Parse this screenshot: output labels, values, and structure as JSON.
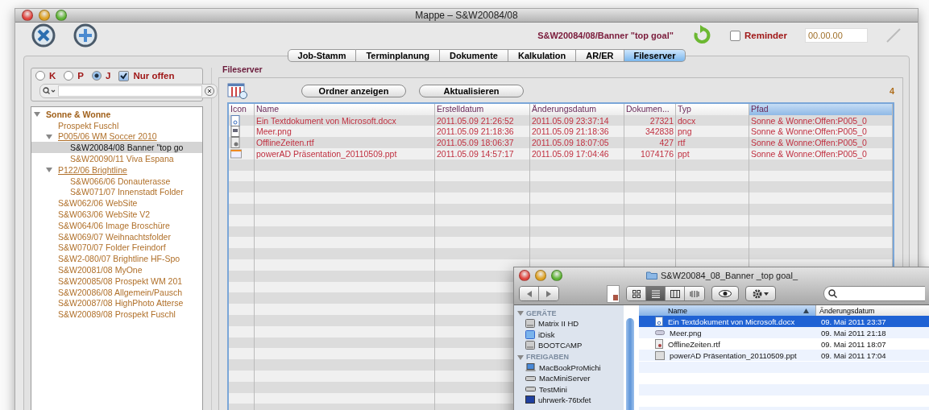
{
  "window": {
    "title": "Mappe – S&W20084/08"
  },
  "toolbar": {
    "job_title": "S&W20084/08/Banner \"top goal\"",
    "reminder": {
      "label": "Reminder",
      "checked": false
    },
    "date_field": {
      "value": "00.00.00"
    }
  },
  "tabs": [
    {
      "label": "Job-Stamm",
      "selected": false
    },
    {
      "label": "Terminplanung",
      "selected": false
    },
    {
      "label": "Dokumente",
      "selected": false
    },
    {
      "label": "Kalkulation",
      "selected": false
    },
    {
      "label": "AR/ER",
      "selected": false
    },
    {
      "label": "Fileserver",
      "selected": true
    }
  ],
  "filter": {
    "radios": [
      {
        "label": "K",
        "selected": false
      },
      {
        "label": "P",
        "selected": false
      },
      {
        "label": "J",
        "selected": true
      }
    ],
    "open_only": {
      "label": "Nur offen",
      "checked": true
    }
  },
  "tree": [
    {
      "label": "Sonne & Wonne",
      "kind": "client",
      "selected": false,
      "expanded": true,
      "children": [
        {
          "label": "Prospekt Fuschl",
          "kind": "job",
          "selected": false
        },
        {
          "label": "P005/06 WM Soccer 2010",
          "kind": "project",
          "selected": false,
          "expanded": true,
          "children": [
            {
              "label": "S&W20084/08 Banner \"top go",
              "kind": "job",
              "selected": true
            },
            {
              "label": "S&W20090/11 Viva Espana",
              "kind": "job",
              "selected": false
            }
          ]
        },
        {
          "label": "P122/06 Brightline",
          "kind": "project",
          "selected": false,
          "expanded": true,
          "children": [
            {
              "label": "S&W066/06 Donauterasse",
              "kind": "job",
              "selected": false
            },
            {
              "label": "S&W071/07 Innenstadt Folder",
              "kind": "job",
              "selected": false
            }
          ]
        },
        {
          "label": "S&W062/06 WebSite",
          "kind": "job",
          "selected": false
        },
        {
          "label": "S&W063/06 WebSite V2",
          "kind": "job",
          "selected": false
        },
        {
          "label": "S&W064/06 Image Broschüre",
          "kind": "job",
          "selected": false
        },
        {
          "label": "S&W069/07 Weihnachtsfolder",
          "kind": "job",
          "selected": false
        },
        {
          "label": "S&W070/07 Folder Freindorf",
          "kind": "job",
          "selected": false
        },
        {
          "label": "S&W2-080/07 Brightline HF-Spo",
          "kind": "job",
          "selected": false
        },
        {
          "label": "S&W20081/08 MyOne",
          "kind": "job",
          "selected": false
        },
        {
          "label": "S&W20085/08 Prospekt WM 201",
          "kind": "job",
          "selected": false
        },
        {
          "label": "S&W20086/08 Allgemein/Pausch",
          "kind": "job",
          "selected": false
        },
        {
          "label": "S&W20087/08 HighPhoto Atterse",
          "kind": "job",
          "selected": false
        },
        {
          "label": "S&W20089/08 Prospekt Fuschl",
          "kind": "job",
          "selected": false
        }
      ]
    }
  ],
  "fileserver": {
    "title": "Fileserver",
    "buttons": [
      "Ordner anzeigen",
      "Aktualisieren"
    ],
    "count": "4",
    "table": {
      "columns": [
        {
          "label": "Icon",
          "selected": false
        },
        {
          "label": "Name",
          "selected": false
        },
        {
          "label": "Erstelldatum",
          "selected": false
        },
        {
          "label": "Änderungsdatum",
          "selected": false
        },
        {
          "label": "Dokumen...",
          "selected": false
        },
        {
          "label": "Typ",
          "selected": false
        },
        {
          "label": "Pfad",
          "selected": true
        }
      ],
      "rows": [
        {
          "kind": "docx",
          "cells": [
            "",
            "Ein Textdokument von Microsoft.docx",
            "2011.05.09 21:26:52",
            "2011.05.09 23:37:14",
            "27321",
            "docx",
            "Sonne & Wonne:Offen:P005_0"
          ]
        },
        {
          "kind": "png",
          "cells": [
            "",
            "Meer.png",
            "2011.05.09 21:18:36",
            "2011.05.09 21:18:36",
            "342838",
            "png",
            "Sonne & Wonne:Offen:P005_0"
          ]
        },
        {
          "kind": "rtf",
          "cells": [
            "",
            "OfflineZeiten.rtf",
            "2011.05.09 18:06:37",
            "2011.05.09 18:07:05",
            "427",
            "rtf",
            "Sonne & Wonne:Offen:P005_0"
          ]
        },
        {
          "kind": "ppt",
          "cells": [
            "",
            "powerAD Präsentation_20110509.ppt",
            "2011.05.09 14:57:17",
            "2011.05.09 17:04:46",
            "1074176",
            "ppt",
            "Sonne & Wonne:Offen:P005_0"
          ]
        }
      ]
    }
  },
  "finder": {
    "title": "S&W20084_08_Banner _top goal_",
    "view_modes": [
      {
        "kind": "icons",
        "selected": false
      },
      {
        "kind": "list",
        "selected": true
      },
      {
        "kind": "columns",
        "selected": false
      },
      {
        "kind": "coverflow",
        "selected": false
      }
    ],
    "sidebar": [
      {
        "heading": "GERÄTE",
        "expanded": true,
        "items": [
          {
            "label": "Matrix II HD",
            "kind": "drive"
          },
          {
            "label": "iDisk",
            "kind": "idisk"
          },
          {
            "label": "BOOTCAMP",
            "kind": "drive"
          }
        ]
      },
      {
        "heading": "FREIGABEN",
        "expanded": true,
        "items": [
          {
            "label": "MacBookProMichi",
            "kind": "laptop"
          },
          {
            "label": "MacMiniServer",
            "kind": "mini"
          },
          {
            "label": "TestMini",
            "kind": "mini"
          },
          {
            "label": "uhrwerk-76txfet",
            "kind": "pc"
          }
        ]
      }
    ],
    "columns": [
      {
        "label": "Name",
        "selected": true
      },
      {
        "label": "Änderungsdatum",
        "selected": false
      }
    ],
    "rows": [
      {
        "name": "Ein Textdokument von Microsoft.docx",
        "date": "09. Mai 2011 23:37",
        "kind": "docx",
        "selected": true
      },
      {
        "name": "Meer.png",
        "date": "09. Mai 2011 21:18",
        "kind": "png",
        "selected": false
      },
      {
        "name": "OfflineZeiten.rtf",
        "date": "09. Mai 2011 18:07",
        "kind": "rtf",
        "selected": false
      },
      {
        "name": "powerAD Präsentation_20110509.ppt",
        "date": "09. Mai 2011 17:04",
        "kind": "ppt",
        "selected": false
      }
    ]
  }
}
